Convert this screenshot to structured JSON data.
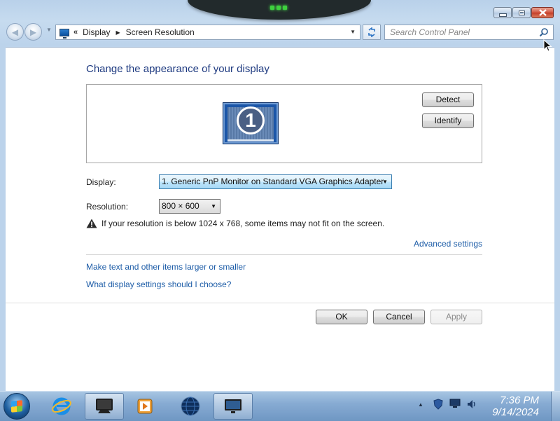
{
  "window": {
    "breadcrumb": [
      "Display",
      "Screen Resolution"
    ],
    "breadcrumb_overflow": "«",
    "search_placeholder": "Search Control Panel"
  },
  "main": {
    "title": "Change the appearance of your display",
    "monitor_number": "1",
    "detect_label": "Detect",
    "identify_label": "Identify",
    "display_label": "Display:",
    "display_value": "1. Generic PnP Monitor on Standard VGA Graphics Adapter",
    "resolution_label": "Resolution:",
    "resolution_value": "800 × 600",
    "warning_text": "If your resolution is below 1024 x 768, some items may not fit on the screen.",
    "advanced_link": "Advanced settings",
    "text_size_link": "Make text and other items larger or smaller",
    "choose_link": "What display settings should I choose?"
  },
  "footer": {
    "ok_label": "OK",
    "cancel_label": "Cancel",
    "apply_label": "Apply"
  },
  "taskbar": {
    "time": "7:36 PM",
    "date": "9/14/2024",
    "items": [
      "start-orb-icon",
      "internet-explorer-icon",
      "display-icon",
      "media-player-icon",
      "globe-icon",
      "screen-resolution-icon"
    ],
    "tray_icons": [
      "shield-icon",
      "network-icon",
      "volume-icon"
    ]
  },
  "colors": {
    "link": "#1f5ea8",
    "title": "#1e3a80",
    "close_button": "#c23b27"
  }
}
